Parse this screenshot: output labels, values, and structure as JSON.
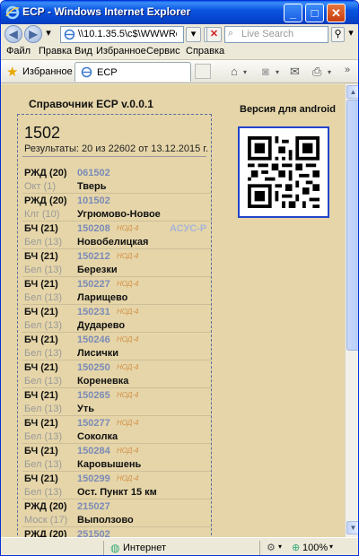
{
  "window": {
    "title": "ЕСР - Windows Internet Explorer",
    "minimize": "_",
    "maximize": "□",
    "close": "✕"
  },
  "address_bar": {
    "url": "\\\\10.1.35.5\\c$\\WWWRo",
    "search_placeholder": "Live Search"
  },
  "menu": [
    "Файл",
    "Правка",
    "Вид",
    "Избранное",
    "Сервис",
    "Справка"
  ],
  "favorites_bar": {
    "favorites_label": "Избранное",
    "tab_label": "ЕСР"
  },
  "page": {
    "app_title": "Справочник ЕСР v.0.0.1",
    "android_label": "Версия для android",
    "query": "1502",
    "summary": "Результаты: 20 из 22602 от 13.12.2015 г.",
    "entries": [
      {
        "rail": "РЖД (20)",
        "region": "Окт (1)",
        "code": "061502",
        "station": "Тверь",
        "nod": "",
        "asus": ""
      },
      {
        "rail": "РЖД (20)",
        "region": "Клг (10)",
        "code": "101502",
        "station": "Угрюмово-Новое",
        "nod": "",
        "asus": ""
      },
      {
        "rail": "БЧ (21)",
        "region": "Бел (13)",
        "code": "150208",
        "station": "Новобелицкая",
        "nod": "НОД-4",
        "asus": "АСУС-Р"
      },
      {
        "rail": "БЧ (21)",
        "region": "Бел (13)",
        "code": "150212",
        "station": "Березки",
        "nod": "НОД-4",
        "asus": ""
      },
      {
        "rail": "БЧ (21)",
        "region": "Бел (13)",
        "code": "150227",
        "station": "Ларищево",
        "nod": "НОД-4",
        "asus": ""
      },
      {
        "rail": "БЧ (21)",
        "region": "Бел (13)",
        "code": "150231",
        "station": "Дударево",
        "nod": "НОД-4",
        "asus": ""
      },
      {
        "rail": "БЧ (21)",
        "region": "Бел (13)",
        "code": "150246",
        "station": "Лисички",
        "nod": "НОД-4",
        "asus": ""
      },
      {
        "rail": "БЧ (21)",
        "region": "Бел (13)",
        "code": "150250",
        "station": "Кореневка",
        "nod": "НОД-4",
        "asus": ""
      },
      {
        "rail": "БЧ (21)",
        "region": "Бел (13)",
        "code": "150265",
        "station": "Уть",
        "nod": "НОД-4",
        "asus": ""
      },
      {
        "rail": "БЧ (21)",
        "region": "Бел (13)",
        "code": "150277",
        "station": "Соколка",
        "nod": "НОД-4",
        "asus": ""
      },
      {
        "rail": "БЧ (21)",
        "region": "Бел (13)",
        "code": "150284",
        "station": "Каровышень",
        "nod": "НОД-4",
        "asus": ""
      },
      {
        "rail": "БЧ (21)",
        "region": "Бел (13)",
        "code": "150299",
        "station": "Ост. Пункт 15 км",
        "nod": "НОД-4",
        "asus": ""
      },
      {
        "rail": "РЖД (20)",
        "region": "Моск (17)",
        "code": "215027",
        "station": "Выползово",
        "nod": "",
        "asus": ""
      },
      {
        "rail": "РЖД (20)",
        "region": "",
        "code": "251502",
        "station": "",
        "nod": "",
        "asus": ""
      }
    ]
  },
  "status_bar": {
    "zone": "Интернет",
    "zoom": "100%"
  },
  "colors": {
    "page_background": "#e5d5a8",
    "code_color": "#7b8bb8",
    "nod_color": "#d4924a",
    "qr_border": "#2244cc"
  }
}
